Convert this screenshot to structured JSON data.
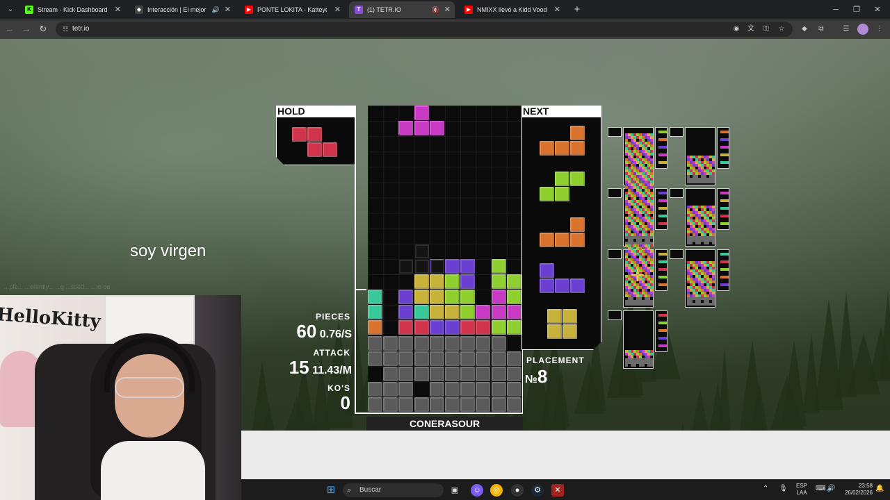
{
  "browser": {
    "tabs": [
      {
        "title": "Stream - Kick Dashboard",
        "favicon": "kick-logo",
        "color": "#53fc18",
        "letter": "K"
      },
      {
        "title": "Interacción | El mejor softw",
        "favicon": "diamond-logo",
        "color": "#dddddd",
        "letter": "◆"
      },
      {
        "title": "PONTE LOKITA - Katteyes x Kid",
        "favicon": "youtube-logo",
        "color": "#ff0000",
        "letter": "▶"
      },
      {
        "title": "(1) TETR.IO",
        "favicon": "tetrio-logo",
        "color": "#8a4dd6",
        "letter": "T"
      },
      {
        "title": "NMIXX llevó a Kidd Voodoo al",
        "favicon": "youtube-logo",
        "color": "#ff0000",
        "letter": "▶"
      }
    ],
    "active_tab_index": 3,
    "url": "tetr.io"
  },
  "overlay": {
    "speech_text": "soy virgen",
    "faint_text": "...ple... ...erently... ...g....ssed... ...to be"
  },
  "game": {
    "hold_label": "HOLD",
    "next_label": "NEXT",
    "pieces_label": "PIECES",
    "pieces_value": "60",
    "pieces_rate": "0.76/S",
    "attack_label": "ATTACK",
    "attack_value": "15",
    "attack_rate": "11.43/M",
    "kos_label": "KO'S",
    "kos_value": "0",
    "placement_label": "PLACEMENT",
    "placement_prefix": "№",
    "placement_value": "8",
    "player_name": "CONERASOUR",
    "hold_piece": "Z",
    "next_queue": [
      "L",
      "S",
      "L",
      "J",
      "O"
    ],
    "colors": {
      "Z": "#d0334a",
      "S": "#8fd02e",
      "L": "#d9732e",
      "J": "#6a3fd2",
      "T": "#c93ac4",
      "O": "#c8b23a",
      "I": "#38c99a",
      "G": "#5a5a5a"
    }
  },
  "taskbar": {
    "search_placeholder": "Buscar",
    "language": "ESP",
    "language_sub": "LAA",
    "time": "23:58",
    "date": "26/02/2026"
  }
}
